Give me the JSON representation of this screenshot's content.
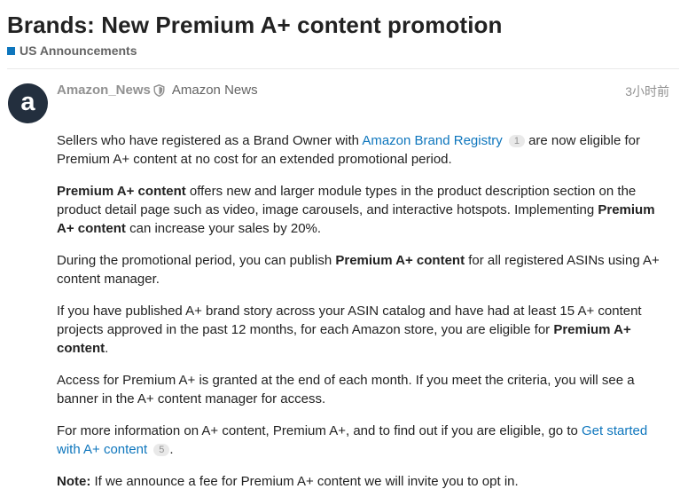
{
  "topic": {
    "title": "Brands: New Premium A+ content promotion",
    "category": {
      "label": "US Announcements",
      "color": "#0E76BD"
    }
  },
  "post": {
    "avatar_letter": "a",
    "avatar_color": "#232f3e",
    "username": "Amazon_News",
    "moderator_icon": "shield-icon",
    "full_name": "Amazon News",
    "timestamp": "3小时前",
    "p1": {
      "t1": "Sellers who have registered as a Brand Owner with ",
      "link": "Amazon Brand Registry",
      "clicks": "1",
      "t2": " are now eligible for Premium A+ content at no cost for an extended promotional period."
    },
    "p2": {
      "b1": "Premium A+ content",
      "t1": " offers new and larger module types in the product description section on the product detail page such as video, image carousels, and interactive hotspots. Implementing ",
      "b2": "Premium A+ content",
      "t2": " can increase your sales by 20%."
    },
    "p3": {
      "t1": "During the promotional period, you can publish ",
      "b1": "Premium A+ content",
      "t2": " for all registered ASINs using A+ content manager."
    },
    "p4": {
      "t1": "If you have published A+ brand story across your ASIN catalog and have had at least 15 A+ content projects approved in the past 12 months, for each Amazon store, you are eligible for ",
      "b1": "Premium A+ content",
      "t2": "."
    },
    "p5": {
      "t1": "Access for Premium A+ is granted at the end of each month. If you meet the criteria, you will see a banner in the A+ content manager for access."
    },
    "p6": {
      "t1": "For more information on A+ content, Premium A+, and to find out if you are eligible, go to ",
      "link": "Get started with A+ content",
      "clicks": "5",
      "t2": "."
    },
    "p7": {
      "b1": "Note:",
      "t1": " If we announce a fee for Premium A+ content we will invite you to opt in."
    }
  }
}
